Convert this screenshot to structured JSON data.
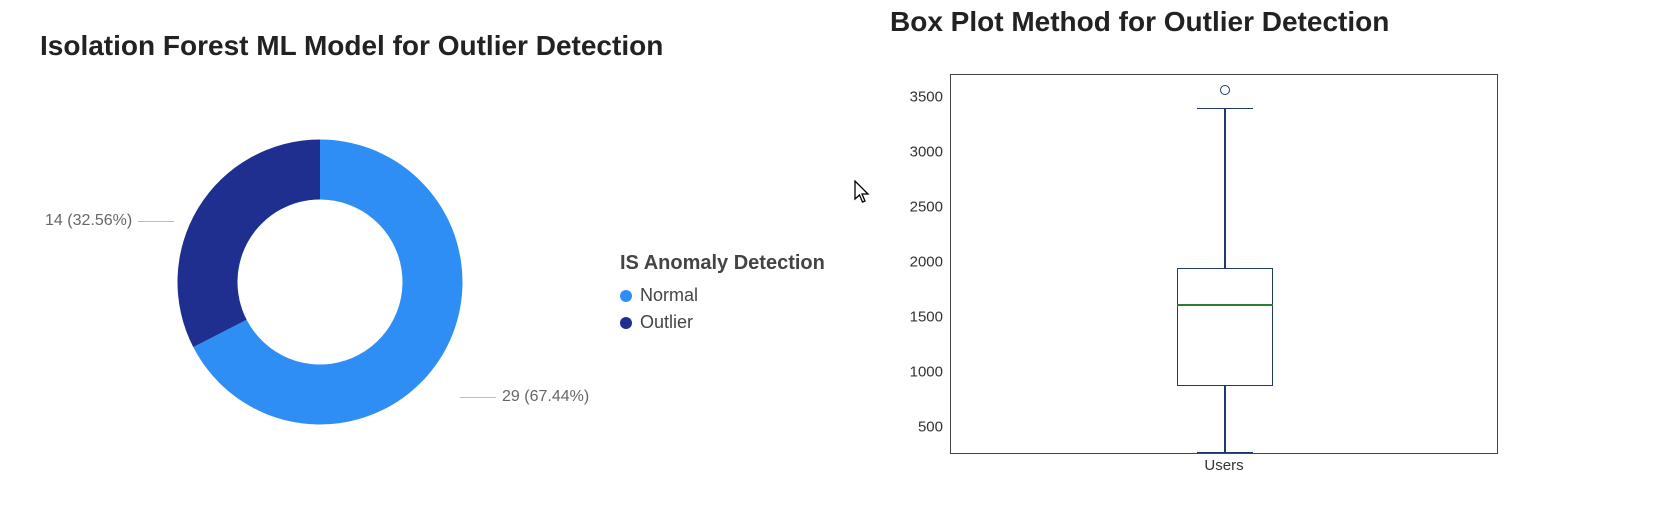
{
  "left": {
    "title": "Isolation Forest ML Model for Outlier Detection",
    "legend_title": "IS Anomaly Detection",
    "callout_outlier": "14 (32.56%)",
    "callout_normal": "29 (67.44%)",
    "legend_items": [
      {
        "label": "Normal",
        "color": "#2f8ef4"
      },
      {
        "label": "Outlier",
        "color": "#1e2f8f"
      }
    ]
  },
  "right": {
    "title": "Box Plot Method for Outlier Detection",
    "xlabel": "Users",
    "yticks": [
      "500",
      "1000",
      "1500",
      "2000",
      "2500",
      "3000",
      "3500"
    ]
  },
  "chart_data": [
    {
      "type": "pie",
      "title": "Isolation Forest ML Model for Outlier Detection",
      "legend_title": "IS Anomaly Detection",
      "donut": true,
      "series": [
        {
          "name": "Normal",
          "value": 29,
          "percent": 67.44,
          "color": "#2f8ef4"
        },
        {
          "name": "Outlier",
          "value": 14,
          "percent": 32.56,
          "color": "#1e2f8f"
        }
      ],
      "start_angle_deg": 0,
      "direction": "clockwise",
      "data_label_format": "{value} ({percent}%)"
    },
    {
      "type": "boxplot",
      "title": "Box Plot Method for Outlier Detection",
      "xlabel": "Users",
      "ylabel": "",
      "ylim": [
        250,
        3700
      ],
      "yticks": [
        500,
        1000,
        1500,
        2000,
        2500,
        3000,
        3500
      ],
      "categories": [
        "Users"
      ],
      "boxes": [
        {
          "category": "Users",
          "whisker_low": 280,
          "q1": 880,
          "median": 1620,
          "q3": 1950,
          "whisker_high": 3400,
          "outliers": [
            3560
          ]
        }
      ],
      "box_color": "#1f3b6e",
      "median_color": "#2e7d32"
    }
  ]
}
